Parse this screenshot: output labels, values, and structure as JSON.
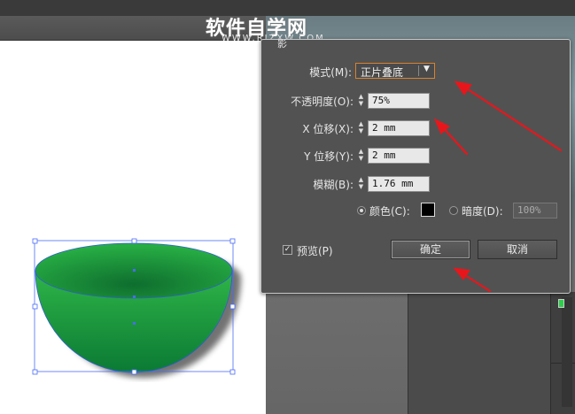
{
  "watermark": {
    "title": "软件自学网",
    "url": "WWW.RJZXW.COM"
  },
  "dialog": {
    "title_fragment": "影",
    "mode": {
      "label": "模式(M):",
      "value": "正片叠底"
    },
    "opacity": {
      "label": "不透明度(O):",
      "value": "75%"
    },
    "x_offset": {
      "label": "X 位移(X):",
      "value": "2 mm"
    },
    "y_offset": {
      "label": "Y 位移(Y):",
      "value": "2 mm"
    },
    "blur": {
      "label": "模糊(B):",
      "value": "1.76 mm"
    },
    "color_option": {
      "label": "颜色(C):",
      "selected": true,
      "swatch": "#000000"
    },
    "darkness_option": {
      "label": "暗度(D):",
      "value": "100%",
      "selected": false
    },
    "preview": {
      "label": "预览(P)",
      "checked": true
    },
    "ok_label": "确定",
    "cancel_label": "取消"
  },
  "colors": {
    "dialog_bg": "#525252",
    "accent_border": "#d9822b",
    "annotation_arrow": "#e8161b",
    "bowl_green": "#1a9a3c",
    "selection_blue": "#4a6cf7"
  }
}
